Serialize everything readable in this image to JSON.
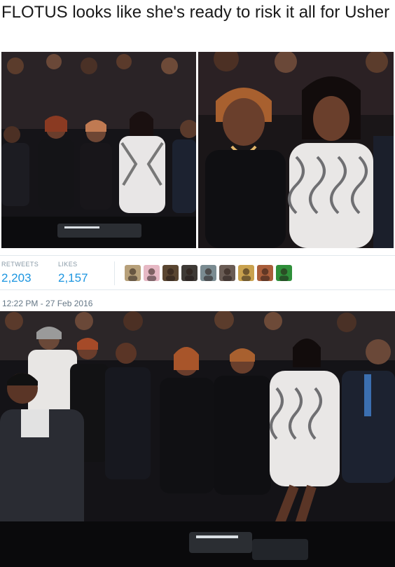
{
  "tweet": {
    "text": "FLOTUS looks like she's ready to risk it all for Usher",
    "timestamp": "12:22 PM - 27 Feb 2016"
  },
  "stats": {
    "retweets_label": "RETWEETS",
    "retweets_count": "2,203",
    "likes_label": "LIKES",
    "likes_count": "2,157"
  },
  "liked_by_avatars": [
    {
      "name": "liker-avatar-1",
      "color": "#b7a07a"
    },
    {
      "name": "liker-avatar-2",
      "color": "#e6b8c4"
    },
    {
      "name": "liker-avatar-3",
      "color": "#5a4631"
    },
    {
      "name": "liker-avatar-4",
      "color": "#3e3a36"
    },
    {
      "name": "liker-avatar-5",
      "color": "#7a8b91"
    },
    {
      "name": "liker-avatar-6",
      "color": "#6a5c55"
    },
    {
      "name": "liker-avatar-7",
      "color": "#c9a24f"
    },
    {
      "name": "liker-avatar-8",
      "color": "#a95e3b"
    },
    {
      "name": "liker-avatar-9",
      "color": "#2f8f3a"
    }
  ],
  "colors": {
    "link_blue": "#1b95e0",
    "muted_gray": "#8899a6",
    "border": "#e1e8ed"
  }
}
